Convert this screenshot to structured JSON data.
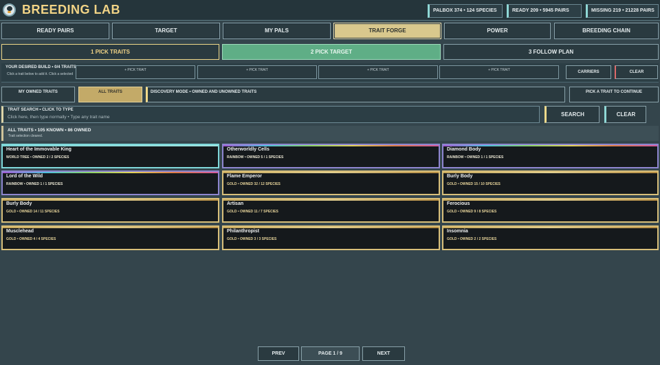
{
  "header": {
    "title": "BREEDING LAB",
    "stats": [
      {
        "label": "PALBOX 374 • 124 SPECIES"
      },
      {
        "label": "READY 209 • 5945 PAIRS"
      },
      {
        "label": "MISSING 219 • 21228 PAIRS"
      }
    ]
  },
  "tabs": [
    {
      "label": "READY PAIRS"
    },
    {
      "label": "TARGET"
    },
    {
      "label": "MY PALS"
    },
    {
      "label": "TRAIT FORGE",
      "active": true
    },
    {
      "label": "POWER"
    },
    {
      "label": "BREEDING CHAIN"
    }
  ],
  "steps": [
    {
      "label": "1  PICK TRAITS"
    },
    {
      "label": "2  PICK TARGET"
    },
    {
      "label": "3  FOLLOW PLAN"
    }
  ],
  "build": {
    "title": "YOUR DESIRED BUILD • 0/4 TRAITS",
    "hint": "Click a trait below to add it. Click a selected",
    "slots": [
      "+ PICK TRAIT",
      "+ PICK TRAIT",
      "+ PICK TRAIT",
      "+ PICK TRAIT"
    ],
    "carriers_label": "CARRIERS",
    "clear_label": "CLEAR"
  },
  "filters": {
    "my_owned": "MY OWNED TRAITS",
    "all": "ALL TRAITS",
    "discovery": "DISCOVERY MODE • OWNED AND UNOWNED TRAITS",
    "pick_prompt": "PICK A TRAIT TO CONTINUE"
  },
  "search": {
    "label": "TRAIT SEARCH • CLICK TO TYPE",
    "value": "",
    "placeholder": "Click here, then type normally • Type any trait name",
    "search_button": "SEARCH",
    "clear_button": "CLEAR"
  },
  "summary": {
    "line": "ALL TRAITS • 105 KNOWN • 86 OWNED",
    "status": "Trait selection cleared."
  },
  "traits": [
    {
      "name": "Heart of the Immovable King",
      "meta": "WORLD TREE • OWNED 2 / 2 SPECIES",
      "rarity": "world"
    },
    {
      "name": "Otherworldly Cells",
      "meta": "RAINBOW • OWNED 5 / 1 SPECIES",
      "rarity": "rainbow"
    },
    {
      "name": "Diamond Body",
      "meta": "RAINBOW • OWNED 1 / 1 SPECIES",
      "rarity": "rainbow"
    },
    {
      "name": "Lord of the Wild",
      "meta": "RAINBOW • OWNED 1 / 1 SPECIES",
      "rarity": "rainbow"
    },
    {
      "name": "Flame Emperor",
      "meta": "GOLD • OWNED 32 / 12 SPECIES",
      "rarity": "gold"
    },
    {
      "name": "Burly Body",
      "meta": "GOLD • OWNED 15 / 10 SPECIES",
      "rarity": "gold"
    },
    {
      "name": "Burly Body",
      "meta": "GOLD • OWNED 14 / 11 SPECIES",
      "rarity": "gold"
    },
    {
      "name": "Artisan",
      "meta": "GOLD • OWNED 11 / 7 SPECIES",
      "rarity": "gold"
    },
    {
      "name": "Ferocious",
      "meta": "GOLD • OWNED 9 / 8 SPECIES",
      "rarity": "gold"
    },
    {
      "name": "Musclehead",
      "meta": "GOLD • OWNED 4 / 4 SPECIES",
      "rarity": "gold"
    },
    {
      "name": "Philanthropist",
      "meta": "GOLD • OWNED 3 / 3 SPECIES",
      "rarity": "gold"
    },
    {
      "name": "Insomnia",
      "meta": "GOLD • OWNED 2 / 2 SPECIES",
      "rarity": "gold"
    }
  ],
  "pagination": {
    "prev": "PREV",
    "page": "PAGE  1 / 9",
    "next": "NEXT"
  },
  "colors": {
    "background": "#34454c",
    "accent_gold": "#f2d486",
    "accent_green": "#5fae86",
    "accent_teal": "#8fd8d6"
  }
}
